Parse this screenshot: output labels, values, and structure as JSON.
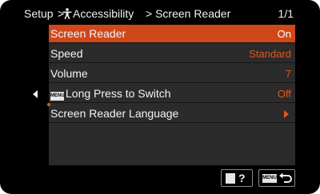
{
  "header": {
    "crumb_setup": "Setup",
    "crumb_sep": ">",
    "crumb_accessibility": "Accessibility",
    "crumb_screen_reader": "> Screen Reader",
    "page_count": "1/1"
  },
  "menu": {
    "items": [
      {
        "label": "Screen Reader",
        "value": "On",
        "selected": true
      },
      {
        "label": "Speed",
        "value": "Standard"
      },
      {
        "label": "Volume",
        "value": "7"
      },
      {
        "badge": "MENU",
        "label": "Long Press to Switch",
        "value": "Off"
      },
      {
        "label": "Screen Reader Language",
        "value_icon": "triangle-right-icon"
      }
    ]
  },
  "footer": {
    "help_icon": "trash-icon",
    "help_glyph": "?",
    "back_badge": "MENU",
    "back_icon": "return-arrow-icon"
  },
  "colors": {
    "background": "#000000",
    "panel": "#2b2b2b",
    "selection": "#d0481a",
    "value_text": "#e8541c"
  }
}
